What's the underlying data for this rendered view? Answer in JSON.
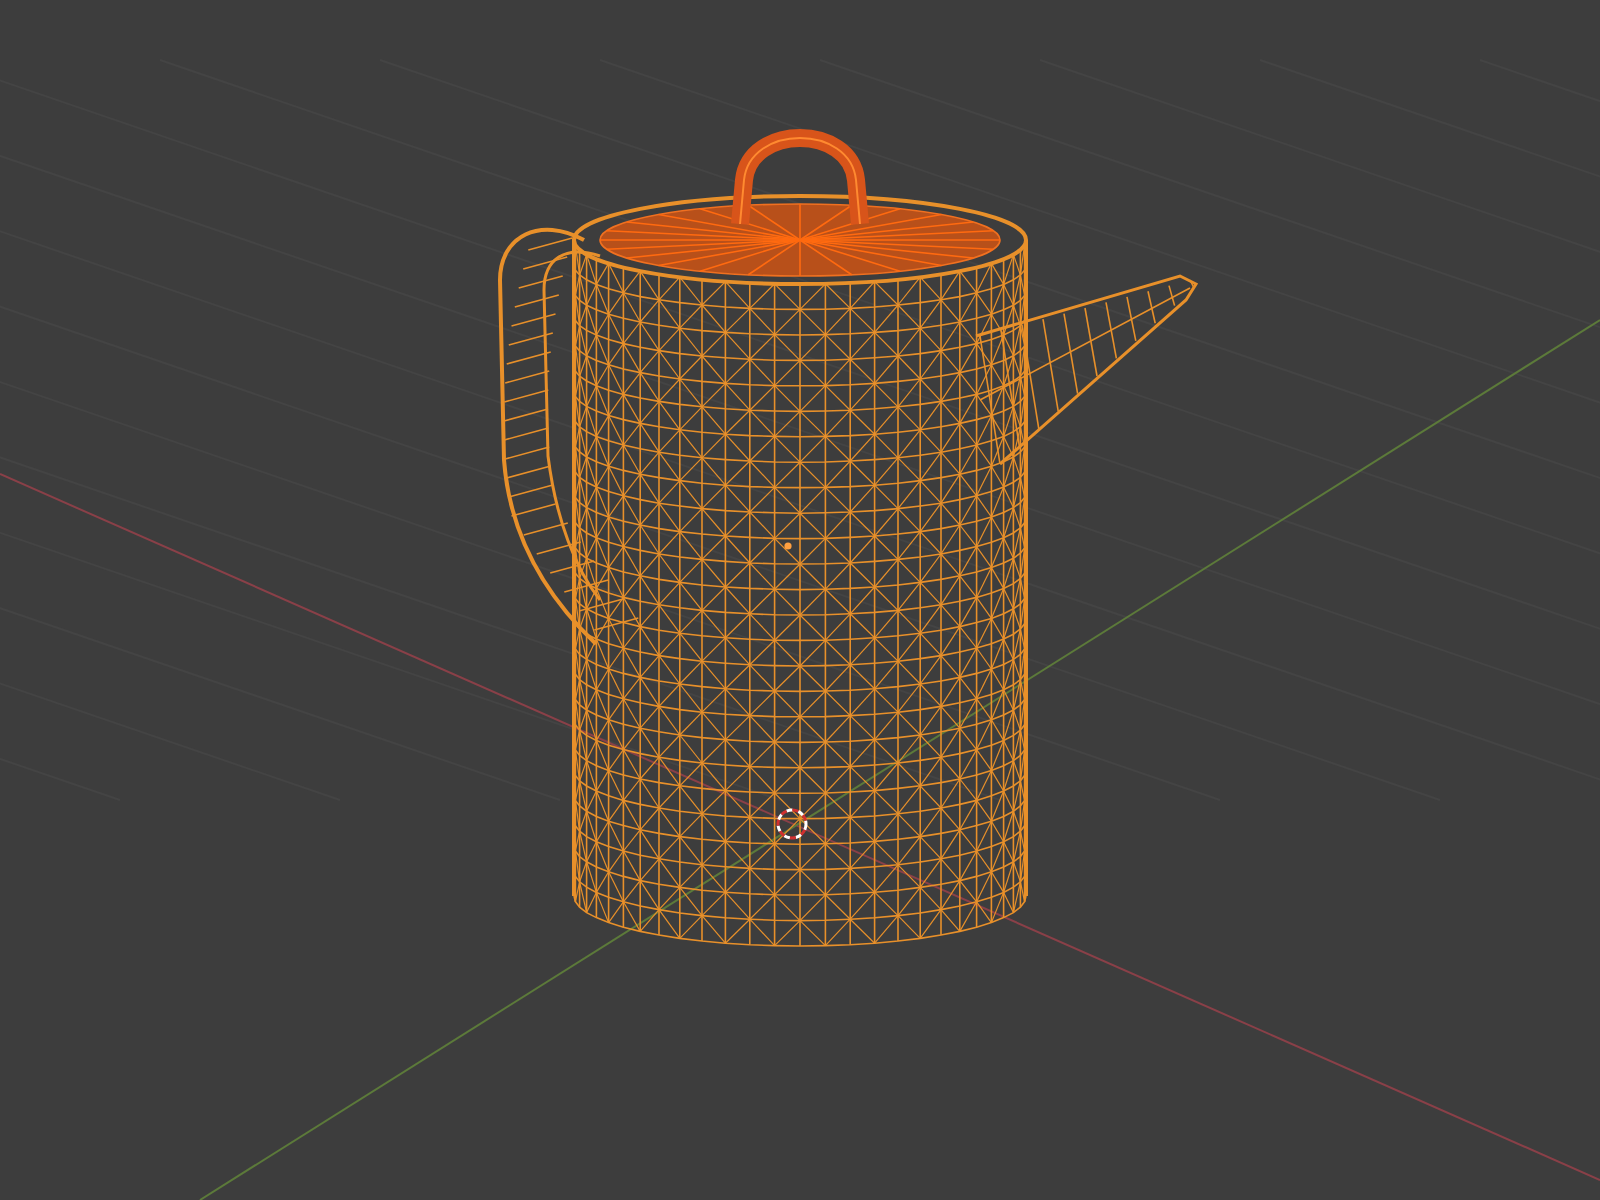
{
  "mesh": {
    "selected": true
  }
}
